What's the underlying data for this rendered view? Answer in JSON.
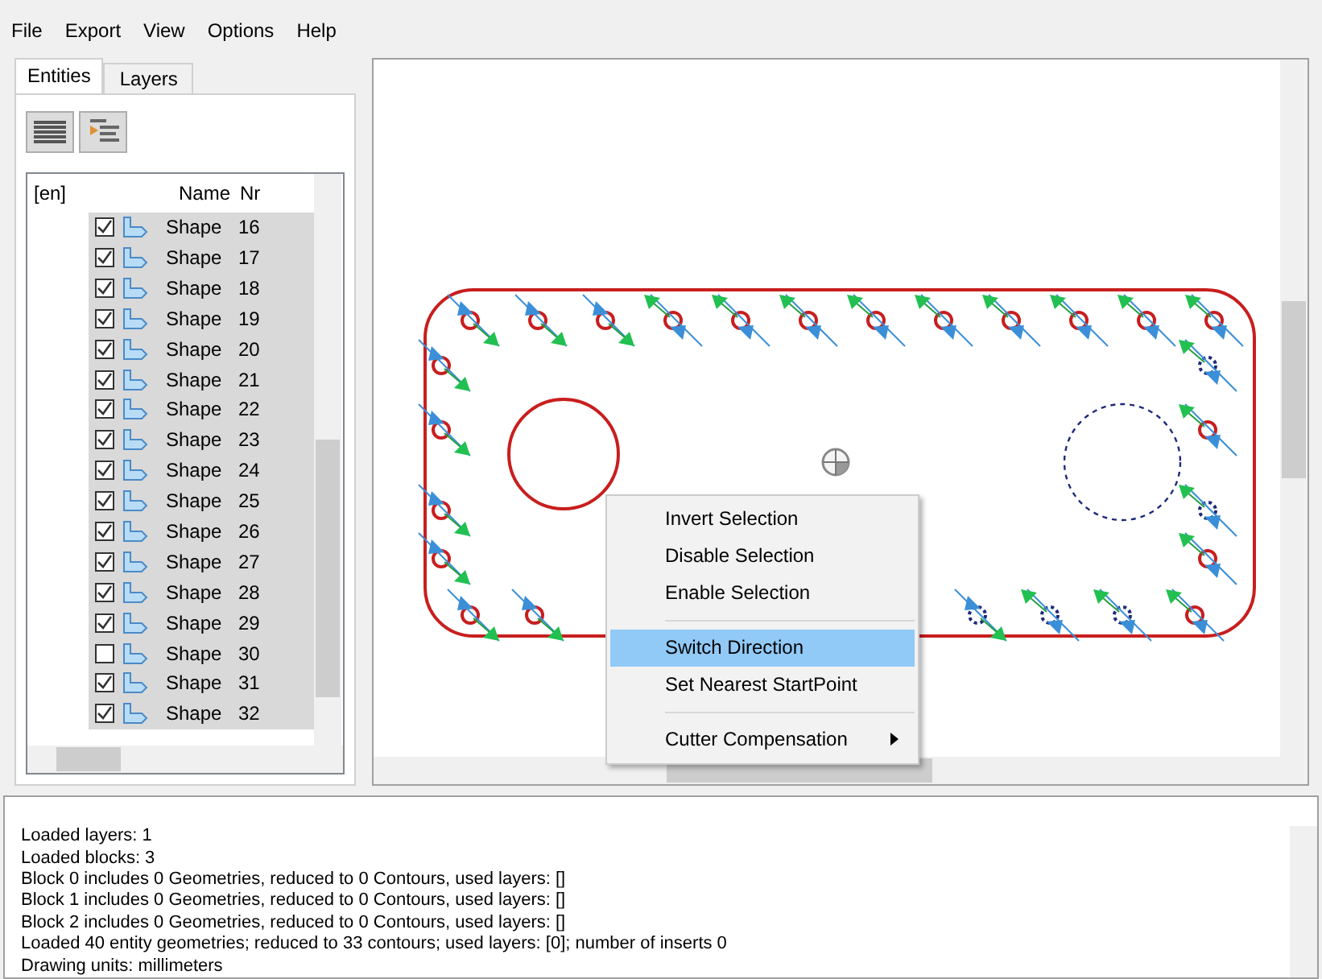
{
  "menu": [
    "File",
    "Export",
    "View",
    "Options",
    "Help"
  ],
  "tabs": [
    {
      "label": "Entities",
      "selected": true
    },
    {
      "label": "Layers",
      "selected": false
    }
  ],
  "tree": {
    "columns": [
      "[en]",
      "Name",
      "Nr"
    ],
    "rows": [
      {
        "name": "Shape",
        "nr": "16",
        "checked": true,
        "selected": true
      },
      {
        "name": "Shape",
        "nr": "17",
        "checked": true,
        "selected": true
      },
      {
        "name": "Shape",
        "nr": "18",
        "checked": true,
        "selected": true
      },
      {
        "name": "Shape",
        "nr": "19",
        "checked": true,
        "selected": true
      },
      {
        "name": "Shape",
        "nr": "20",
        "checked": true,
        "selected": true
      },
      {
        "name": "Shape",
        "nr": "21",
        "checked": true,
        "selected": true
      },
      {
        "name": "Shape",
        "nr": "22",
        "checked": true,
        "selected": true
      },
      {
        "name": "Shape",
        "nr": "23",
        "checked": true,
        "selected": true
      },
      {
        "name": "Shape",
        "nr": "24",
        "checked": true,
        "selected": true
      },
      {
        "name": "Shape",
        "nr": "25",
        "checked": true,
        "selected": true
      },
      {
        "name": "Shape",
        "nr": "26",
        "checked": true,
        "selected": true
      },
      {
        "name": "Shape",
        "nr": "27",
        "checked": true,
        "selected": true
      },
      {
        "name": "Shape",
        "nr": "28",
        "checked": true,
        "selected": true
      },
      {
        "name": "Shape",
        "nr": "29",
        "checked": true,
        "selected": true
      },
      {
        "name": "Shape",
        "nr": "30",
        "checked": false,
        "selected": true
      },
      {
        "name": "Shape",
        "nr": "31",
        "checked": true,
        "selected": true
      },
      {
        "name": "Shape",
        "nr": "32",
        "checked": true,
        "selected": true
      }
    ]
  },
  "context_menu": [
    {
      "kind": "item",
      "label": "Invert Selection",
      "selected": false
    },
    {
      "kind": "item",
      "label": "Disable Selection",
      "selected": false
    },
    {
      "kind": "item",
      "label": "Enable Selection",
      "selected": false
    },
    {
      "kind": "separator"
    },
    {
      "kind": "item",
      "label": "Switch Direction",
      "selected": true
    },
    {
      "kind": "item",
      "label": "Set Nearest StartPoint",
      "selected": false
    },
    {
      "kind": "separator"
    },
    {
      "kind": "submenu",
      "label": "Cutter Compensation",
      "selected": false
    }
  ],
  "log": [
    "Loaded layers: 1",
    "Loaded blocks: 3",
    "Block 0 includes 0 Geometries, reduced to 0 Contours, used layers: []",
    "Block 1 includes 0 Geometries, reduced to 0 Contours, used layers: []",
    "Block 2 includes 0 Geometries, reduced to 0 Contours, used layers: []",
    "Loaded 40 entity geometries; reduced to 33 contours; used layers: [0]; number of inserts 0",
    "Drawing units: millimeters"
  ]
}
